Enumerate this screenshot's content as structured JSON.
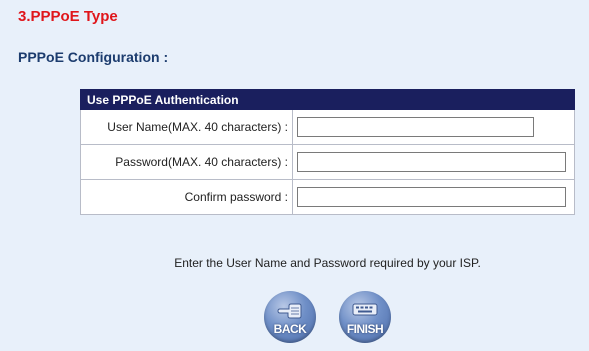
{
  "header": {
    "title": "3.PPPoE Type",
    "subtitle": "PPPoE Configuration :"
  },
  "form": {
    "heading": "Use PPPoE Authentication",
    "fields": [
      {
        "label": "User Name(MAX. 40 characters) :",
        "value": ""
      },
      {
        "label": "Password(MAX. 40 characters) :",
        "value": ""
      },
      {
        "label": "Confirm password :",
        "value": ""
      }
    ]
  },
  "hint": "Enter the User Name and Password required by your ISP.",
  "buttons": {
    "back": {
      "label": "BACK",
      "icon": "pointing-hand-icon"
    },
    "finish": {
      "label": "FINISH",
      "icon": "keyboard-icon"
    }
  },
  "colors": {
    "background": "#e8f0fa",
    "title": "#e0161b",
    "subtitle": "#1c3c6e",
    "table_header": "#1a1f5e",
    "button": "#6f8fc7"
  }
}
